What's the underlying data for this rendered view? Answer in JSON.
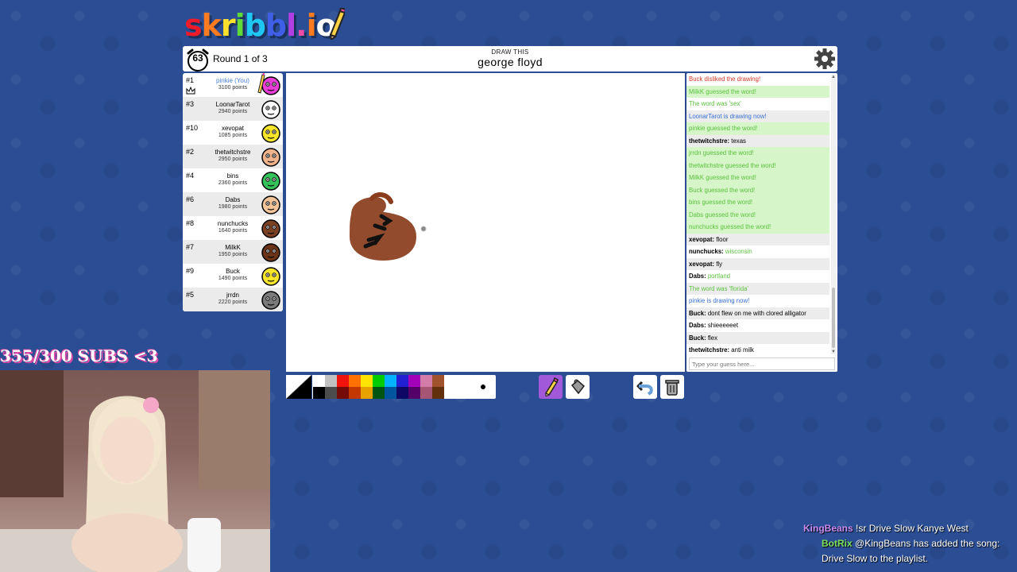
{
  "app": {
    "logo_text": "skribbl.io",
    "logo_colors": [
      "#ef1b2a",
      "#ff7b1f",
      "#ffe02b",
      "#62d93b",
      "#1fc8f2",
      "#3f5fe8",
      "#b23ee4",
      "#ef4ba7",
      "#ff7b1f",
      "#ffffff"
    ]
  },
  "header": {
    "timer": "63",
    "round": "Round 1 of 3",
    "hint_label": "DRAW THIS",
    "word": "george floyd",
    "settings_icon": "gear-icon"
  },
  "players": [
    {
      "rank": "#1",
      "name": "pinkie (You)",
      "points": "3100 points",
      "you": true,
      "crown": true,
      "drawing": true,
      "avatar_color": "#e83ed8"
    },
    {
      "rank": "#3",
      "name": "LoonarTarot",
      "points": "2940 points",
      "avatar_color": "#ffffff"
    },
    {
      "rank": "#10",
      "name": "xevopat",
      "points": "1085 points",
      "avatar_color": "#f6e52a"
    },
    {
      "rank": "#2",
      "name": "thetwitchstre",
      "points": "2950 points",
      "avatar_color": "#f0b48c"
    },
    {
      "rank": "#4",
      "name": "bins",
      "points": "2360 points",
      "avatar_color": "#34c25a"
    },
    {
      "rank": "#6",
      "name": "Dabs",
      "points": "1980 points",
      "avatar_color": "#f2c49a"
    },
    {
      "rank": "#8",
      "name": "nunchucks",
      "points": "1640 points",
      "avatar_color": "#7a4022"
    },
    {
      "rank": "#7",
      "name": "MilkK",
      "points": "1950 points",
      "avatar_color": "#6b3318"
    },
    {
      "rank": "#9",
      "name": "Buck",
      "points": "1490 points",
      "avatar_color": "#f6e52a"
    },
    {
      "rank": "#5",
      "name": "jrrdn",
      "points": "2220 points",
      "avatar_color": "#7a7a7a"
    }
  ],
  "chat": {
    "messages": [
      {
        "type": "red",
        "text": "Buck disliked the drawing!"
      },
      {
        "type": "green-bg",
        "text": "MilkK guessed the word!"
      },
      {
        "type": "green",
        "text": "The word was 'sex'"
      },
      {
        "type": "blue",
        "text": "LoonarTarot is drawing now!"
      },
      {
        "type": "green-bg",
        "text": "pinkie guessed the word!"
      },
      {
        "type": "user",
        "author": "thetwitchstre:",
        "text": " texas"
      },
      {
        "type": "green-bg",
        "text": "jrrdn guessed the word!"
      },
      {
        "type": "green-bg",
        "text": "thetwitchstre guessed the word!"
      },
      {
        "type": "green-bg",
        "text": "MilkK guessed the word!"
      },
      {
        "type": "green-bg",
        "text": "Buck guessed the word!"
      },
      {
        "type": "green-bg",
        "text": "bins guessed the word!"
      },
      {
        "type": "green-bg",
        "text": "Dabs guessed the word!"
      },
      {
        "type": "green-bg",
        "text": "nunchucks guessed the word!"
      },
      {
        "type": "user",
        "author": "xevopat:",
        "text": " floor"
      },
      {
        "type": "close",
        "author": "nunchucks:",
        "text": " wisconsin"
      },
      {
        "type": "user",
        "author": "xevopat:",
        "text": " fly"
      },
      {
        "type": "close",
        "author": "Dabs:",
        "text": " portland"
      },
      {
        "type": "green",
        "text": "The word was 'florida'"
      },
      {
        "type": "blue",
        "text": "pinkie is drawing now!"
      },
      {
        "type": "user",
        "author": "Buck:",
        "text": " dont flew on me with clored alligator"
      },
      {
        "type": "user",
        "author": "Dabs:",
        "text": " shieeeeeet"
      },
      {
        "type": "user",
        "author": "Buck:",
        "text": " flex"
      },
      {
        "type": "user",
        "author": "thetwitchstre:",
        "text": " anti milk"
      }
    ],
    "input_placeholder": "Type your guess here..."
  },
  "toolbar": {
    "palette": [
      "#ffffff",
      "#c1c1c1",
      "#ef130b",
      "#ff7100",
      "#ffe400",
      "#00cc00",
      "#00b2ff",
      "#231fd3",
      "#a300ba",
      "#d37caa",
      "#a0522d",
      "#000000",
      "#4c4c4c",
      "#740b07",
      "#c23800",
      "#e8a200",
      "#005510",
      "#00569e",
      "#0e0865",
      "#550069",
      "#a75574",
      "#63300d"
    ],
    "tools": [
      {
        "name": "pencil-tool",
        "icon": "pencil-icon",
        "active": true
      },
      {
        "name": "fill-tool",
        "icon": "bucket-icon",
        "active": false
      },
      {
        "name": "undo-tool",
        "icon": "undo-icon",
        "active": false
      },
      {
        "name": "clear-tool",
        "icon": "trash-icon",
        "active": false
      }
    ]
  },
  "overlay": {
    "sub_goal": "355/300 SUBS <3",
    "stream_chat": [
      {
        "user": "KingBeans",
        "color": "#c88cf2",
        "text": "!sr Drive Slow Kanye West"
      },
      {
        "user": "BotRix",
        "color": "#7ee05a",
        "text": "@KingBeans has added the song: Drive Slow to the playlist."
      }
    ]
  }
}
